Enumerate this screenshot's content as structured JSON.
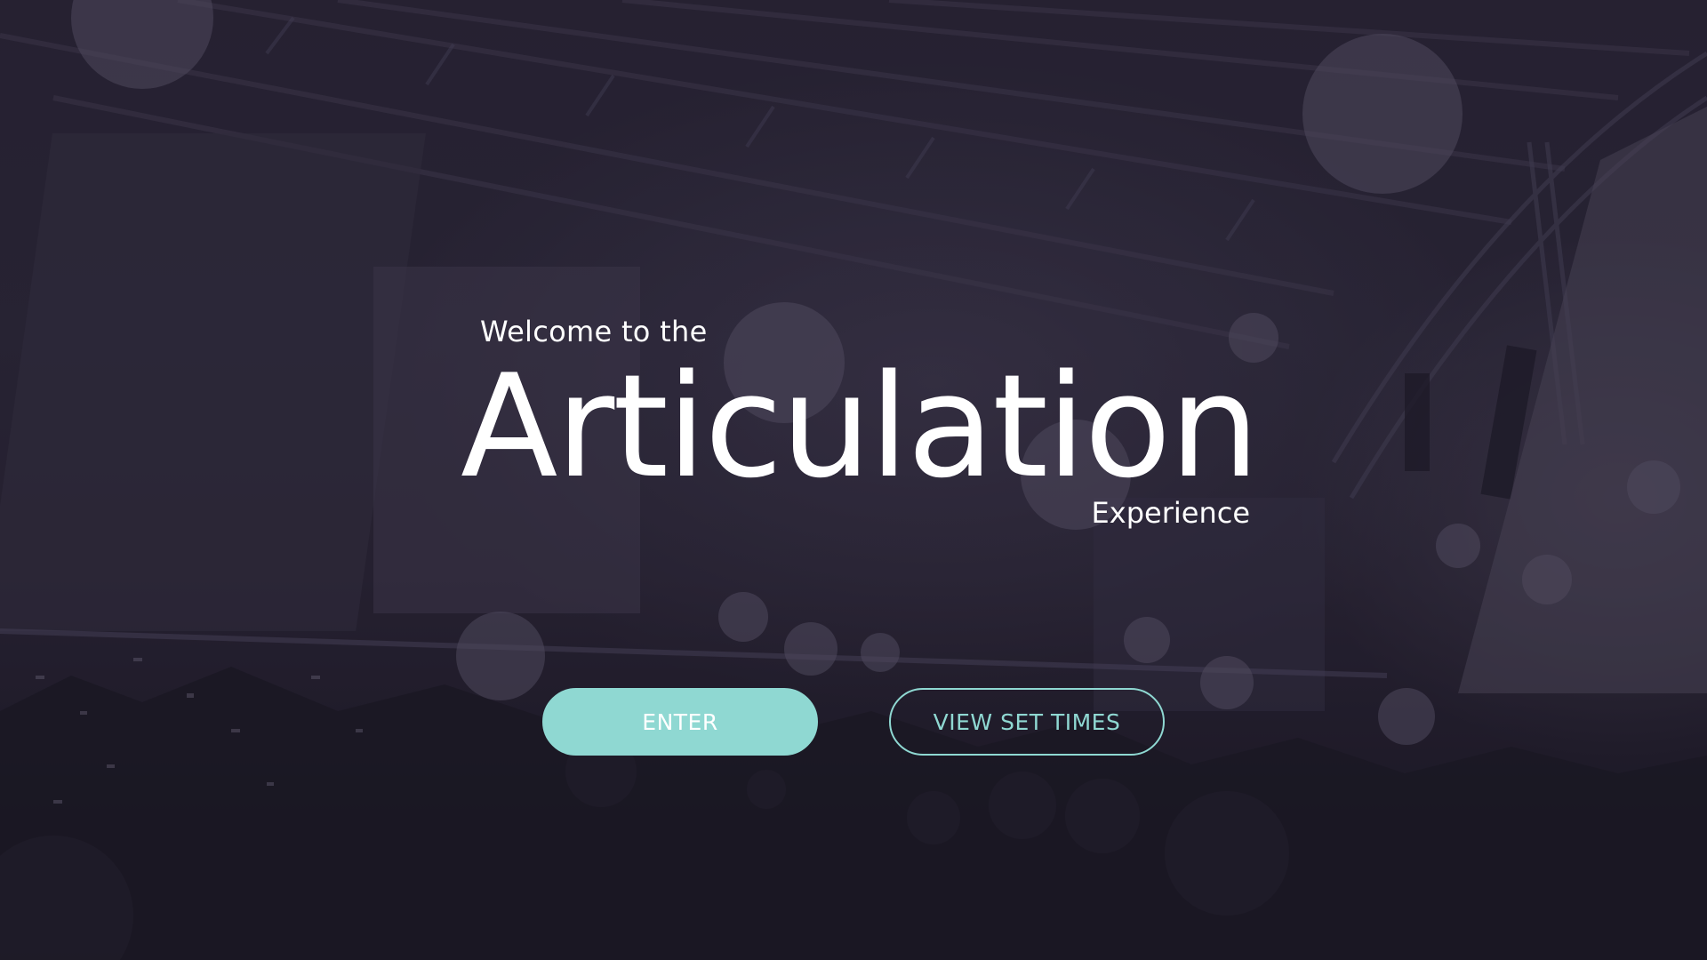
{
  "hero": {
    "welcome_text": "Welcome to the",
    "title": "Articulation",
    "subtitle": "Experience"
  },
  "buttons": {
    "enter_label": "ENTER",
    "set_times_label": "VIEW SET TIMES"
  },
  "colors": {
    "accent": "#8fd8d2",
    "overlay": "#2a2433",
    "text": "#ffffff"
  }
}
